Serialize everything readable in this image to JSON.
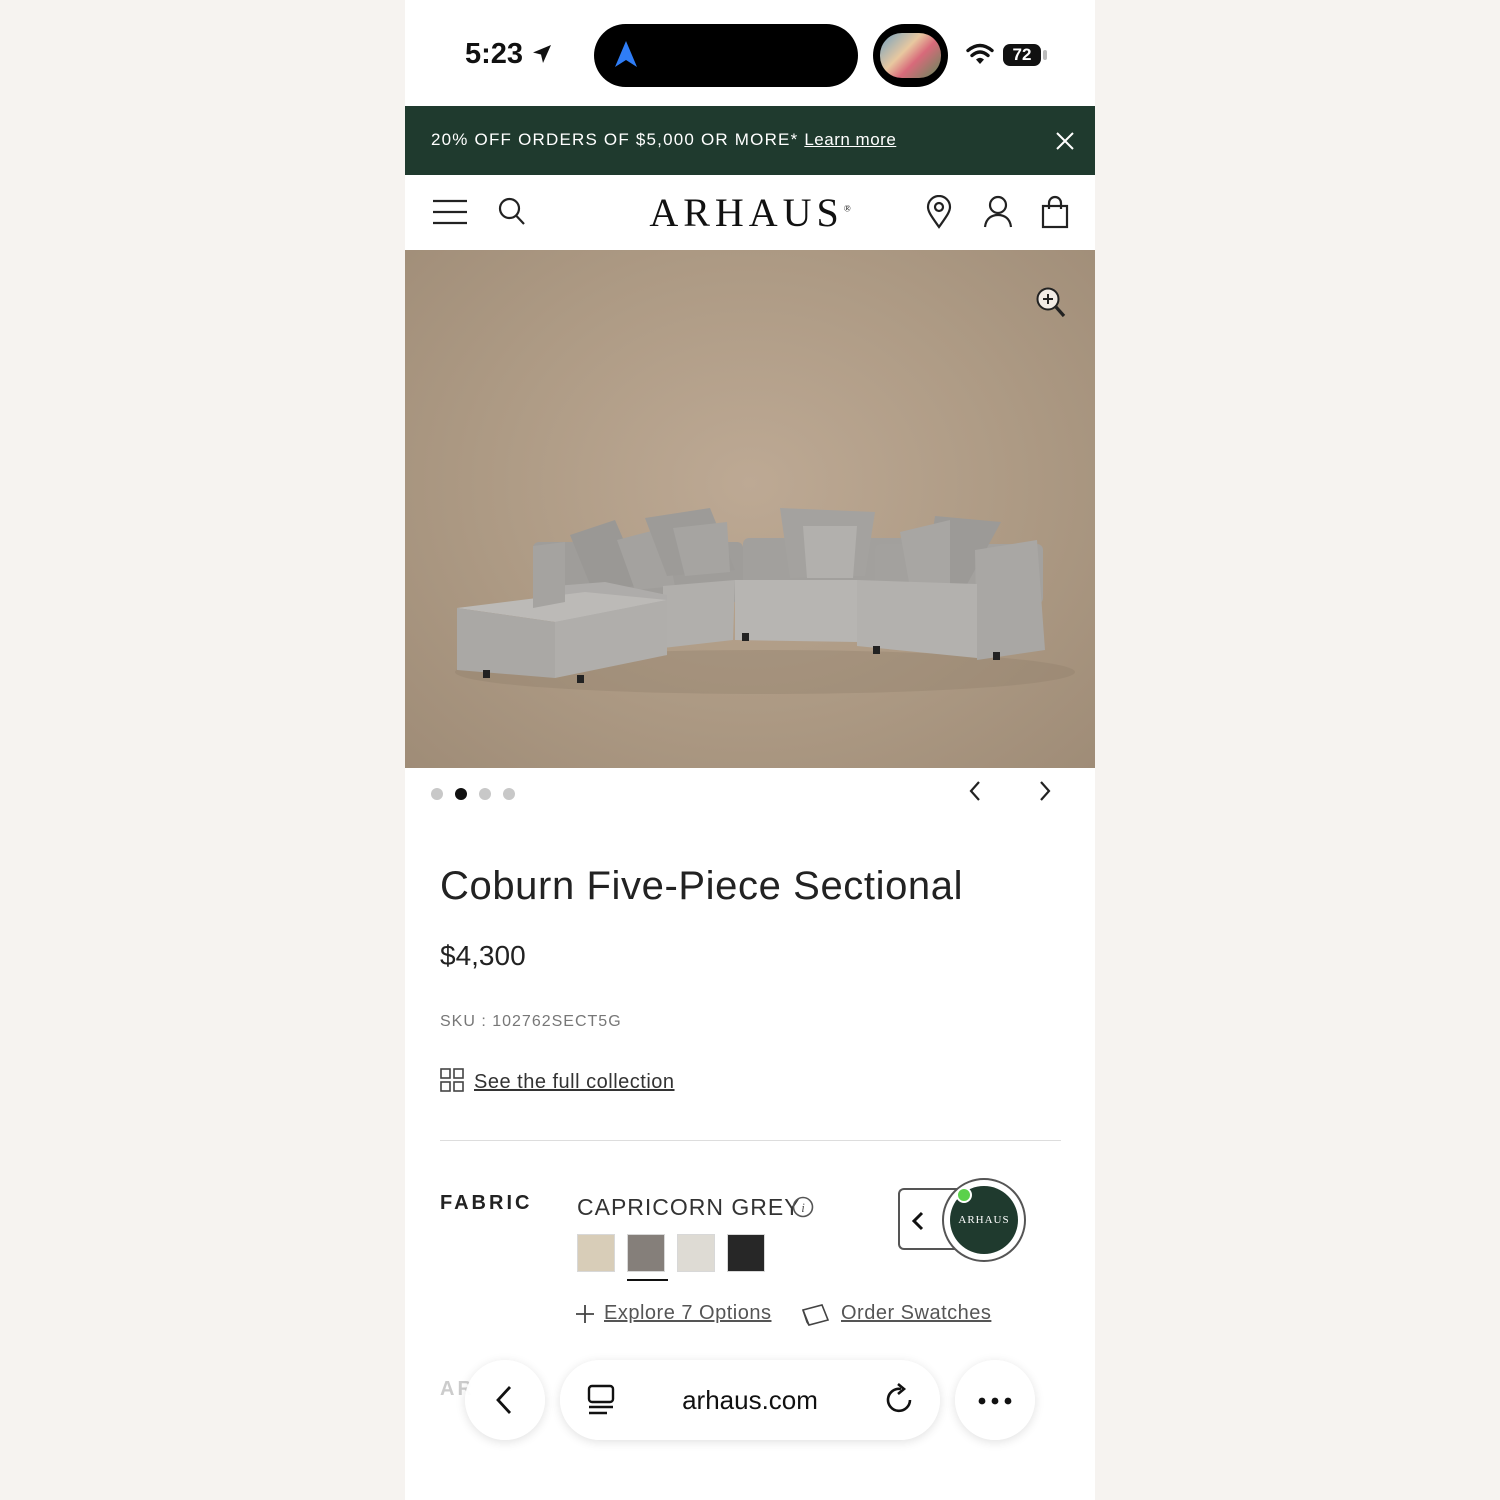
{
  "status_bar": {
    "time": "5:23",
    "battery": "72"
  },
  "promo": {
    "text": "20% OFF ORDERS OF $5,000 OR MORE*",
    "link": "Learn more"
  },
  "header": {
    "logo": "ARHAUS"
  },
  "carousel": {
    "slide_count": 4,
    "active_index": 2
  },
  "product": {
    "title": "Coburn Five-Piece Sectional",
    "price": "$4,300",
    "sku": "SKU : 102762SECT5G",
    "collection_link": "See the full collection"
  },
  "fabric": {
    "label": "FABRIC",
    "selected_name": "CAPRICORN GREY",
    "swatches": [
      "#d8cdb8",
      "#857f7a",
      "#dedbd4",
      "#272727"
    ],
    "selected_index": 2,
    "explore_link": "Explore 7 Options",
    "order_link": "Order Swatches"
  },
  "chat": {
    "logo": "ARHAUS"
  },
  "next_section": {
    "label": "AR"
  },
  "browser": {
    "url": "arhaus.com"
  },
  "colors": {
    "brand_green": "#1f3a2e",
    "online_dot": "#5bd14a"
  }
}
